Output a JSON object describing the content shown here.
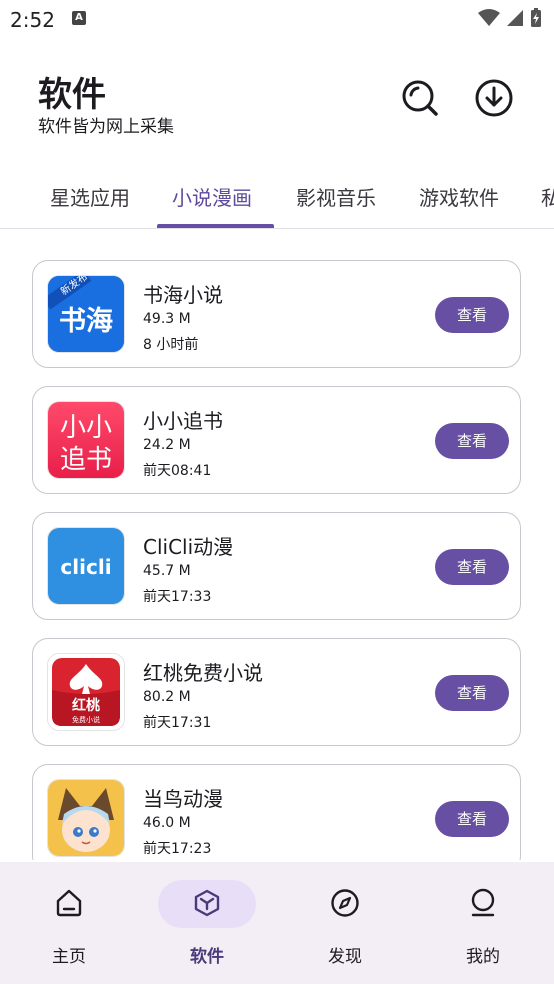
{
  "status": {
    "time": "2:52",
    "notification_icon": "a-icon"
  },
  "header": {
    "title": "软件",
    "subtitle": "软件皆为网上采集"
  },
  "tabs": [
    {
      "label": "星选应用"
    },
    {
      "label": "小说漫画",
      "active": true
    },
    {
      "label": "影视音乐"
    },
    {
      "label": "游戏软件"
    },
    {
      "label": "私"
    }
  ],
  "apps": [
    {
      "name": "书海小说",
      "size": "49.3 M",
      "time": "8 小时前",
      "button": "查看",
      "icon_text": "书海",
      "badge": "新发布"
    },
    {
      "name": "小小追书",
      "size": "24.2 M",
      "time": "前天08:41",
      "button": "查看",
      "icon_text_top": "小小",
      "icon_text_bottom": "追书"
    },
    {
      "name": "CliCli动漫",
      "size": "45.7 M",
      "time": "前天17:33",
      "button": "查看",
      "icon_text": "clicli"
    },
    {
      "name": "红桃免费小说",
      "size": "80.2 M",
      "time": "前天17:31",
      "button": "查看",
      "icon_text": "红桃",
      "icon_sub": "免费小说"
    },
    {
      "name": "当鸟动漫",
      "size": "46.0 M",
      "time": "前天17:23",
      "button": "查看"
    }
  ],
  "nav": [
    {
      "label": "主页",
      "icon": "home-icon"
    },
    {
      "label": "软件",
      "icon": "cube-icon",
      "active": true
    },
    {
      "label": "发现",
      "icon": "compass-icon"
    },
    {
      "label": "我的",
      "icon": "person-icon"
    }
  ],
  "colors": {
    "accent": "#6750a4",
    "nav_bg": "#f3eef6",
    "pill": "#e8def8"
  }
}
